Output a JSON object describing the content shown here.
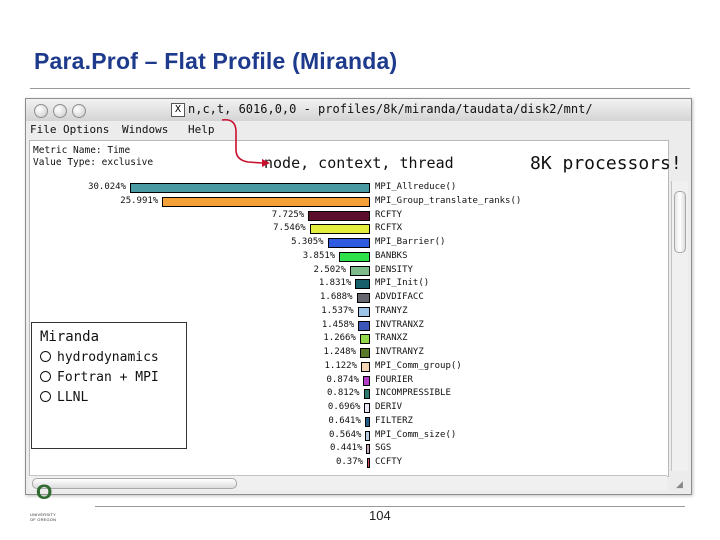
{
  "slide": {
    "title": "Para.Prof – Flat Profile (Miranda)",
    "page_number": "104",
    "callout_node": "node, context, thread",
    "callout_processors": "8K processors!"
  },
  "window": {
    "title_icon": "X",
    "title": "n,c,t, 6016,0,0 - profiles/8k/miranda/taudata/disk2/mnt/",
    "menu": [
      "File",
      "Options",
      "Windows",
      "Help"
    ],
    "metric_name": "Metric Name: Time",
    "value_type": "Value Type: exclusive"
  },
  "chart_data": {
    "type": "bar",
    "orientation": "horizontal",
    "value_unit": "percent",
    "rows": [
      {
        "pct": "30.024%",
        "value": 30.024,
        "name": "MPI_Allreduce()",
        "color": "#4a9aa3"
      },
      {
        "pct": "25.991%",
        "value": 25.991,
        "name": "MPI_Group_translate_ranks()",
        "color": "#f5a13a"
      },
      {
        "pct": "7.725%",
        "value": 7.725,
        "name": "RCFTY",
        "color": "#5b0f2d"
      },
      {
        "pct": "7.546%",
        "value": 7.546,
        "name": "RCFTX",
        "color": "#e3ef3c"
      },
      {
        "pct": "5.305%",
        "value": 5.305,
        "name": "MPI_Barrier()",
        "color": "#2f5be0"
      },
      {
        "pct": "3.851%",
        "value": 3.851,
        "name": "BANBKS",
        "color": "#2ee04a"
      },
      {
        "pct": "2.502%",
        "value": 2.502,
        "name": "DENSITY",
        "color": "#7dbb8a"
      },
      {
        "pct": "1.831%",
        "value": 1.831,
        "name": "MPI_Init()",
        "color": "#17606b"
      },
      {
        "pct": "1.688%",
        "value": 1.688,
        "name": "ADVDIFACC",
        "color": "#66666e"
      },
      {
        "pct": "1.537%",
        "value": 1.537,
        "name": "TRANYZ",
        "color": "#9cc3e8"
      },
      {
        "pct": "1.458%",
        "value": 1.458,
        "name": "INVTRANXZ",
        "color": "#3a56b8"
      },
      {
        "pct": "1.266%",
        "value": 1.266,
        "name": "TRANXZ",
        "color": "#8fd94a"
      },
      {
        "pct": "1.248%",
        "value": 1.248,
        "name": "INVTRANYZ",
        "color": "#5a7a2a"
      },
      {
        "pct": "1.122%",
        "value": 1.122,
        "name": "MPI_Comm_group()",
        "color": "#f3d7b5"
      },
      {
        "pct": "0.874%",
        "value": 0.874,
        "name": "FOURIER",
        "color": "#b43cc8"
      },
      {
        "pct": "0.812%",
        "value": 0.812,
        "name": "INCOMPRESSIBLE",
        "color": "#2a7a70"
      },
      {
        "pct": "0.696%",
        "value": 0.696,
        "name": "DERIV",
        "color": "#e8e8f8"
      },
      {
        "pct": "0.641%",
        "value": 0.641,
        "name": "FILTERZ",
        "color": "#1f5f8a"
      },
      {
        "pct": "0.564%",
        "value": 0.564,
        "name": "MPI_Comm_size()",
        "color": "#b9cde0"
      },
      {
        "pct": "0.441%",
        "value": 0.441,
        "name": "SGS",
        "color": "#c9a7c0"
      },
      {
        "pct": "0.37%",
        "value": 0.37,
        "name": "CCFTY",
        "color": "#d04a5a"
      }
    ]
  },
  "info_box": {
    "title": "Miranda",
    "bullets": [
      "hydrodynamics",
      "Fortran + MPI",
      "LLNL"
    ]
  },
  "logo": {
    "letter": "O",
    "text_lines": [
      "UNIVERSITY",
      "OF OREGON"
    ],
    "brand_color": "#2f6b30"
  }
}
